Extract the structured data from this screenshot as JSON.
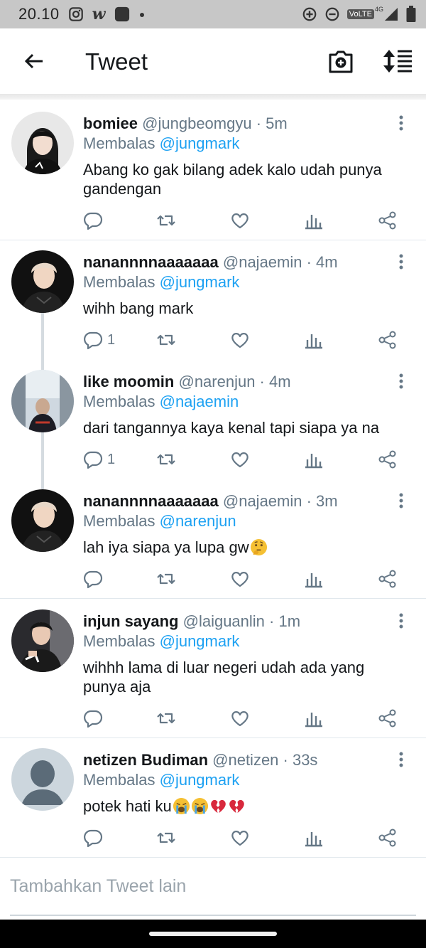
{
  "status_bar": {
    "time": "20.10",
    "app_letter": "w",
    "network_label": "VoLTE",
    "network_gen": "4G",
    "icons": [
      "instagram-icon",
      "wattpad-icon",
      "app-icon",
      "dot-icon",
      "data-saver-icon",
      "do-not-disturb-icon",
      "signal-icon",
      "battery-icon"
    ]
  },
  "header": {
    "title": "Tweet",
    "icons": [
      "back-arrow-icon",
      "camera-add-icon",
      "sort-icon"
    ]
  },
  "tweets": [
    {
      "name": "bomiee",
      "handle": "@jungbeomgyu",
      "time": "5m",
      "meta": "@jungbeomgyu · 5m",
      "reply_prefix": "Membalas",
      "reply_to": "@jungmark",
      "text": "Abang ko gak bilang adek kalo udah punya gandengan",
      "reply_count": ""
    },
    {
      "name": "nanannnnaaaaaaa",
      "handle": "@najaemin",
      "time": "4m",
      "meta": "@najaemin · 4m",
      "reply_prefix": "Membalas",
      "reply_to": "@jungmark",
      "text": "wihh bang mark",
      "reply_count": "1"
    },
    {
      "name": "like moomin",
      "handle": "@narenjun",
      "time": "4m",
      "meta": "@narenjun · 4m",
      "reply_prefix": "Membalas",
      "reply_to": "@najaemin",
      "text": "dari tangannya kaya kenal tapi siapa ya na",
      "reply_count": "1"
    },
    {
      "name": "nanannnnaaaaaaa",
      "handle": "@najaemin",
      "time": "3m",
      "meta": "@najaemin · 3m",
      "reply_prefix": "Membalas",
      "reply_to": "@narenjun",
      "text": "lah iya siapa ya lupa gw",
      "emojis": [
        "thinking-face-emoji"
      ],
      "reply_count": ""
    },
    {
      "name": "injun sayang",
      "handle": "@laiguanlin",
      "time": "1m",
      "meta": "@laiguanlin · 1m",
      "reply_prefix": "Membalas",
      "reply_to": "@jungmark",
      "text": "wihhh lama di luar negeri udah ada yang punya aja",
      "reply_count": ""
    },
    {
      "name": "netizen Budiman",
      "handle": "@netizen",
      "time": "33s",
      "meta": "@netizen · 33s",
      "reply_prefix": "Membalas",
      "reply_to": "@jungmark",
      "text": "potek hati ku",
      "emojis": [
        "crying-face-emoji",
        "crying-face-emoji",
        "broken-heart-emoji",
        "broken-heart-emoji"
      ],
      "reply_count": ""
    }
  ],
  "action_icons": [
    "reply-icon",
    "retweet-icon",
    "like-icon",
    "analytics-icon",
    "share-icon"
  ],
  "compose": {
    "placeholder": "Tambahkan Tweet lain"
  },
  "colors": {
    "link": "#1da1f2",
    "secondary_text": "#657786",
    "status_bar": "#c7c7c7",
    "thread_line": "#d5dbe0"
  }
}
